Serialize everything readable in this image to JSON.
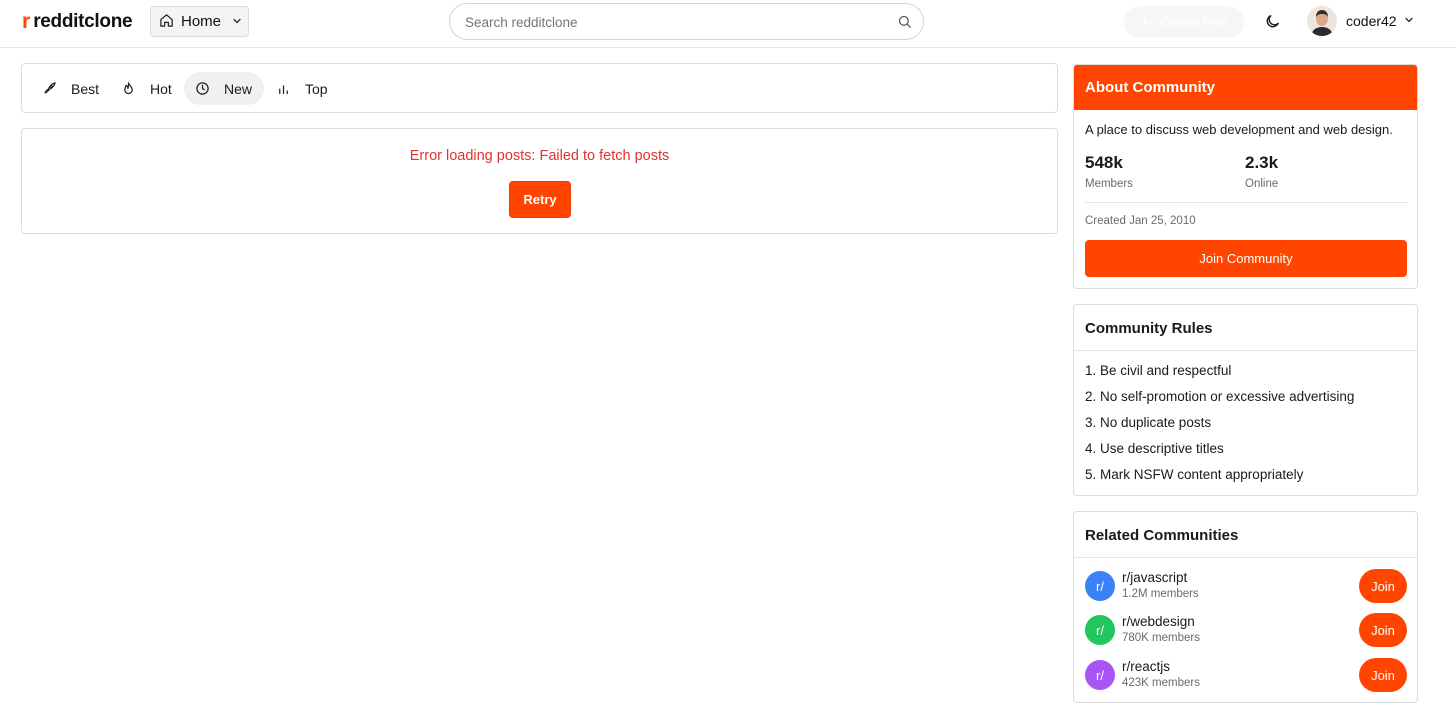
{
  "header": {
    "logo_mark": "r",
    "logo_text": "redditclone",
    "home_label": "Home",
    "search_placeholder": "Search redditclone",
    "create_post_label": "Create Post",
    "username": "coder42"
  },
  "sort": {
    "items": [
      {
        "label": "Best",
        "icon": "rocket-icon"
      },
      {
        "label": "Hot",
        "icon": "flame-icon"
      },
      {
        "label": "New",
        "icon": "clock-icon",
        "active": true
      },
      {
        "label": "Top",
        "icon": "bar-chart-icon"
      }
    ]
  },
  "feed": {
    "error_message": "Error loading posts: Failed to fetch posts",
    "retry_label": "Retry"
  },
  "about": {
    "title": "About Community",
    "description": "A place to discuss web development and web design.",
    "members_count": "548k",
    "members_label": "Members",
    "online_count": "2.3k",
    "online_label": "Online",
    "created": "Created Jan 25, 2010",
    "join_label": "Join Community"
  },
  "rules": {
    "title": "Community Rules",
    "items": [
      "1.  Be civil and respectful",
      "2.  No self-promotion or excessive advertising",
      "3.  No duplicate posts",
      "4.  Use descriptive titles",
      "5.  Mark NSFW content appropriately"
    ]
  },
  "related": {
    "title": "Related Communities",
    "items": [
      {
        "avatar": "r/",
        "name": "r/javascript",
        "members": "1.2M members",
        "color": "#3b82f6",
        "join": "Join"
      },
      {
        "avatar": "r/",
        "name": "r/webdesign",
        "members": "780K members",
        "color": "#22c55e",
        "join": "Join"
      },
      {
        "avatar": "r/",
        "name": "r/reactjs",
        "members": "423K members",
        "color": "#a855f7",
        "join": "Join"
      }
    ]
  },
  "colors": {
    "accent": "#ff4500",
    "error": "#e0322d"
  }
}
